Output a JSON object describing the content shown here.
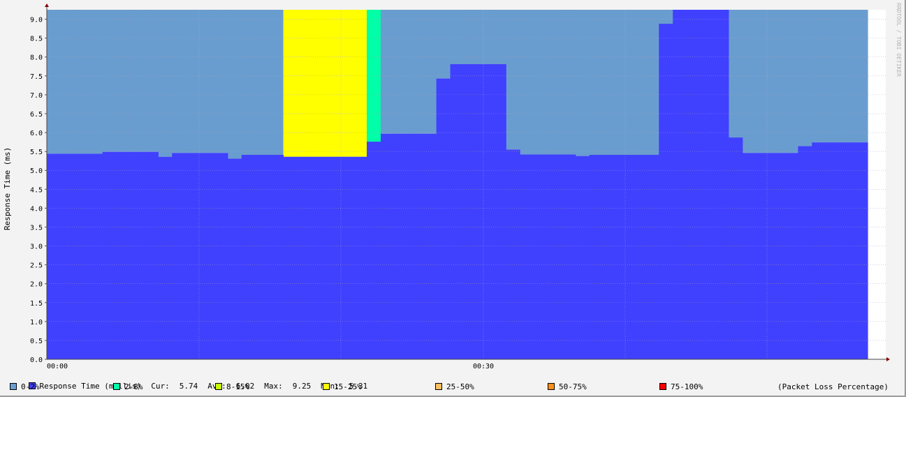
{
  "chart_data": {
    "type": "area",
    "title": "",
    "xlabel": "",
    "ylabel": "Response Time (ms)",
    "ylim": [
      0,
      9.25
    ],
    "y_ticks": [
      "0.0",
      "0.5",
      "1.0",
      "1.5",
      "2.0",
      "2.5",
      "3.0",
      "3.5",
      "4.0",
      "4.5",
      "5.0",
      "5.5",
      "6.0",
      "6.5",
      "7.0",
      "7.5",
      "8.0",
      "8.5",
      "9.0"
    ],
    "x_tick_labels": [
      "00:00",
      "00:30"
    ],
    "grid": true,
    "watermark": "RRDTOOL / TOBI OETIKER",
    "series": [
      {
        "name": "Response Time (millis)",
        "color": "#4040ff",
        "values": [
          5.44,
          5.44,
          5.44,
          5.44,
          5.49,
          5.49,
          5.49,
          5.49,
          5.36,
          5.46,
          5.46,
          5.46,
          5.46,
          5.31,
          5.41,
          5.41,
          5.41,
          5.36,
          5.36,
          5.36,
          5.36,
          5.36,
          5.36,
          5.76,
          5.97,
          5.97,
          5.97,
          5.97,
          7.43,
          7.81,
          7.81,
          7.81,
          7.81,
          5.55,
          5.42,
          5.42,
          5.42,
          5.42,
          5.38,
          5.41,
          5.41,
          5.41,
          5.41,
          5.41,
          8.88,
          9.25,
          9.25,
          9.25,
          9.25,
          5.87,
          5.46,
          5.46,
          5.46,
          5.46,
          5.64,
          5.74,
          5.74,
          5.74,
          5.74
        ]
      }
    ],
    "packet_loss_band_colors": [
      "#6a9dcf",
      "#6a9dcf",
      "#6a9dcf",
      "#6a9dcf",
      "#6a9dcf",
      "#6a9dcf",
      "#6a9dcf",
      "#6a9dcf",
      "#6a9dcf",
      "#6a9dcf",
      "#6a9dcf",
      "#6a9dcf",
      "#6a9dcf",
      "#6a9dcf",
      "#6a9dcf",
      "#6a9dcf",
      "#6a9dcf",
      "#ffff00",
      "#ffff00",
      "#ffff00",
      "#ffff00",
      "#ffff00",
      "#ffff00",
      "#00ffa6",
      "#6a9dcf",
      "#6a9dcf",
      "#6a9dcf",
      "#6a9dcf",
      "#6a9dcf",
      "#6a9dcf",
      "#6a9dcf",
      "#6a9dcf",
      "#6a9dcf",
      "#6a9dcf",
      "#6a9dcf",
      "#6a9dcf",
      "#6a9dcf",
      "#6a9dcf",
      "#6a9dcf",
      "#6a9dcf",
      "#6a9dcf",
      "#6a9dcf",
      "#6a9dcf",
      "#6a9dcf",
      "#6a9dcf",
      "#6a9dcf",
      "#6a9dcf",
      "#6a9dcf",
      "#6a9dcf",
      "#6a9dcf",
      "#6a9dcf",
      "#6a9dcf",
      "#6a9dcf",
      "#6a9dcf",
      "#6a9dcf",
      "#6a9dcf",
      "#6a9dcf",
      "#6a9dcf",
      "#6a9dcf"
    ],
    "stats": {
      "series_label": "Response Time (millis)",
      "cur_label": "Cur:",
      "cur": "5.74",
      "avg_label": "Avg:",
      "avg": "6.02",
      "max_label": "Max:",
      "max": "9.25",
      "min_label": "Min:",
      "min": "5.31"
    },
    "loss_legend": [
      {
        "label": "0-2%",
        "color": "#6a9dcf"
      },
      {
        "label": "2-8%",
        "color": "#00ffa6"
      },
      {
        "label": "8-15%",
        "color": "#c8ff00"
      },
      {
        "label": "15-25%",
        "color": "#ffff00"
      },
      {
        "label": "25-50%",
        "color": "#ffc060"
      },
      {
        "label": "50-75%",
        "color": "#ff9018"
      },
      {
        "label": "75-100%",
        "color": "#ff0000"
      }
    ],
    "loss_legend_note": "(Packet Loss Percentage)"
  }
}
